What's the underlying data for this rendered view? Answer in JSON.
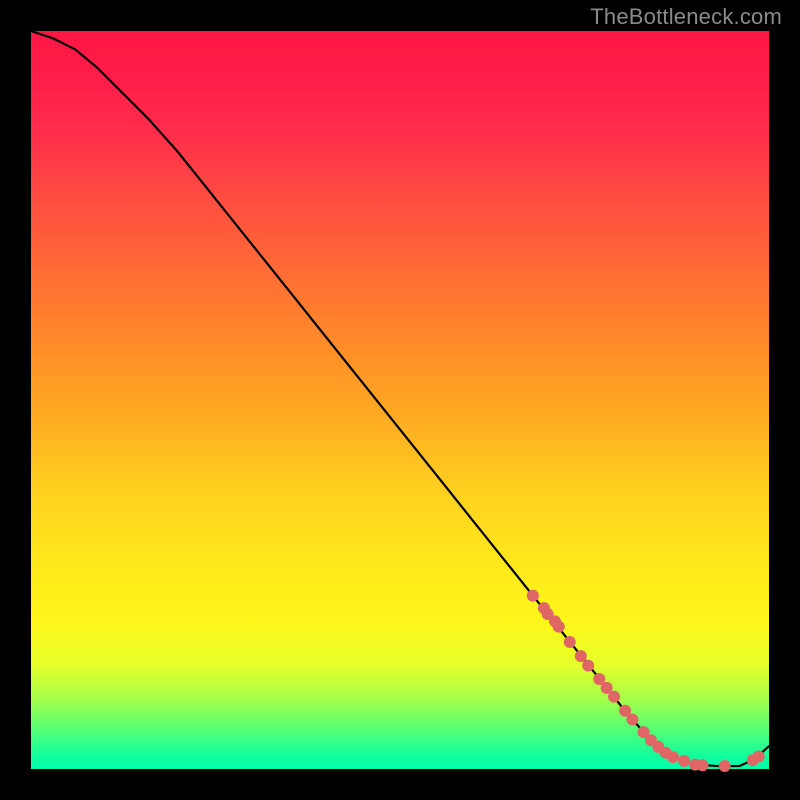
{
  "attribution": "TheBottleneck.com",
  "chart_data": {
    "type": "line",
    "title": "",
    "xlabel": "",
    "ylabel": "",
    "xlim": [
      0,
      100
    ],
    "ylim": [
      0,
      100
    ],
    "grid": false,
    "legend": false,
    "series": [
      {
        "name": "bottleneck-curve",
        "color": "#000000",
        "x": [
          0,
          3,
          6,
          9,
          12,
          16,
          20,
          24,
          28,
          32,
          36,
          40,
          44,
          48,
          52,
          56,
          60,
          64,
          68,
          72,
          76,
          80,
          83,
          85,
          88,
          90,
          93,
          96,
          98,
          100
        ],
        "y": [
          100,
          99,
          97.5,
          95,
          92,
          88,
          83.5,
          78.5,
          73.5,
          68.5,
          63.5,
          58.5,
          53.5,
          48.5,
          43.5,
          38.5,
          33.5,
          28.5,
          23.5,
          18.5,
          13.5,
          8.5,
          5,
          3,
          1.2,
          0.6,
          0.4,
          0.4,
          1.3,
          3.1
        ]
      }
    ],
    "markers": [
      {
        "name": "hardware-points",
        "color": "#e06666",
        "radius": 6,
        "x": [
          68,
          69.5,
          70,
          71,
          71.5,
          73,
          74.5,
          75.5,
          77,
          78,
          79,
          80.5,
          81.5,
          83,
          84,
          85,
          86,
          87,
          88.5,
          90,
          91,
          94,
          97.8,
          98.6
        ],
        "y": [
          23.5,
          21.8,
          21,
          20,
          19.3,
          17.2,
          15.3,
          14,
          12.2,
          11,
          9.8,
          7.9,
          6.7,
          5,
          3.9,
          3,
          2.2,
          1.6,
          1.1,
          0.6,
          0.5,
          0.4,
          1.2,
          1.7
        ]
      }
    ]
  }
}
